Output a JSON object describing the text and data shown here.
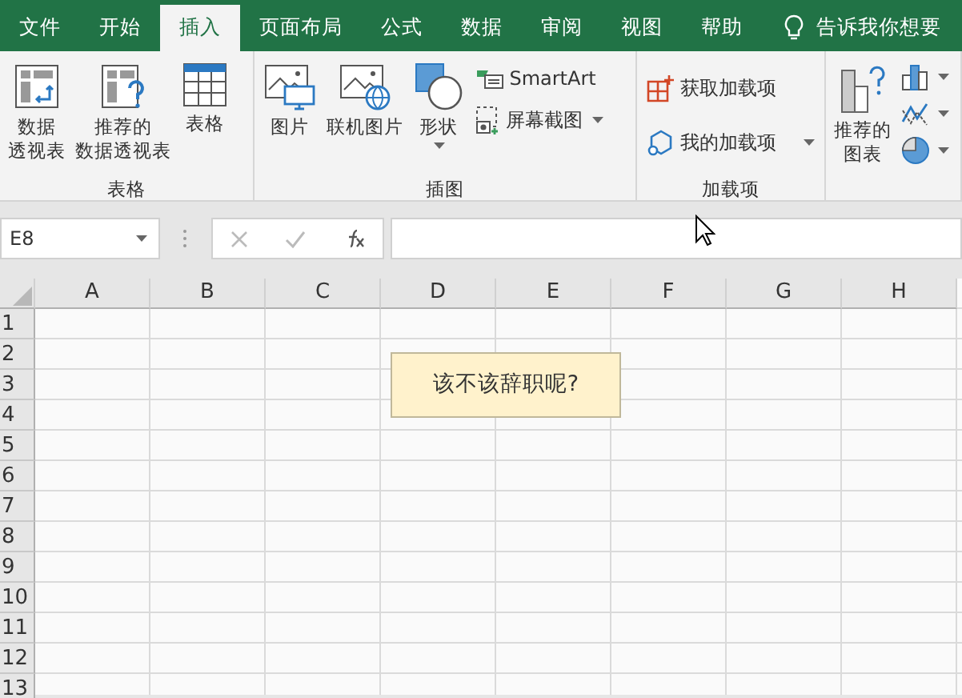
{
  "tabs": [
    {
      "label": "文件",
      "selected": false
    },
    {
      "label": "开始",
      "selected": false
    },
    {
      "label": "插入",
      "selected": true
    },
    {
      "label": "页面布局",
      "selected": false
    },
    {
      "label": "公式",
      "selected": false
    },
    {
      "label": "数据",
      "selected": false
    },
    {
      "label": "审阅",
      "selected": false
    },
    {
      "label": "视图",
      "selected": false
    },
    {
      "label": "帮助",
      "selected": false
    }
  ],
  "tell_me": "告诉我你想要",
  "ribbon_groups": [
    {
      "label": "表格",
      "buttons": [
        {
          "kind": "large",
          "lines": [
            "数据",
            "透视表"
          ],
          "dropdown": false
        },
        {
          "kind": "large",
          "lines": [
            "推荐的",
            "数据透视表"
          ],
          "dropdown": false
        },
        {
          "kind": "large",
          "lines": [
            "表格"
          ],
          "dropdown": false
        }
      ]
    },
    {
      "label": "插图",
      "buttons": [
        {
          "kind": "large",
          "lines": [
            "图片"
          ],
          "dropdown": false
        },
        {
          "kind": "large",
          "lines": [
            "联机图片"
          ],
          "dropdown": false
        },
        {
          "kind": "large",
          "lines": [
            "形状"
          ],
          "dropdown": true
        },
        {
          "kind": "small",
          "lines": [
            "SmartArt"
          ],
          "dropdown": false
        },
        {
          "kind": "small",
          "lines": [
            "屏幕截图"
          ],
          "dropdown": true
        }
      ]
    },
    {
      "label": "加载项",
      "buttons": [
        {
          "kind": "small",
          "lines": [
            "获取加载项"
          ],
          "dropdown": false
        },
        {
          "kind": "small",
          "lines": [
            "我的加载项"
          ],
          "dropdown": true
        }
      ]
    },
    {
      "buttons": [
        {
          "kind": "large",
          "lines": [
            "推荐的",
            "图表"
          ],
          "dropdown": false
        },
        {
          "kind": "icon",
          "dropdown": true
        },
        {
          "kind": "icon",
          "dropdown": true
        },
        {
          "kind": "icon",
          "dropdown": true
        }
      ]
    }
  ],
  "name_box": "E8",
  "columns": [
    "A",
    "B",
    "C",
    "D",
    "E",
    "F",
    "G",
    "H"
  ],
  "rows": [
    "1",
    "2",
    "3",
    "4",
    "5",
    "6",
    "7",
    "8",
    "9",
    "10",
    "11",
    "12",
    "13"
  ],
  "text_box": "该不该辞职呢?"
}
